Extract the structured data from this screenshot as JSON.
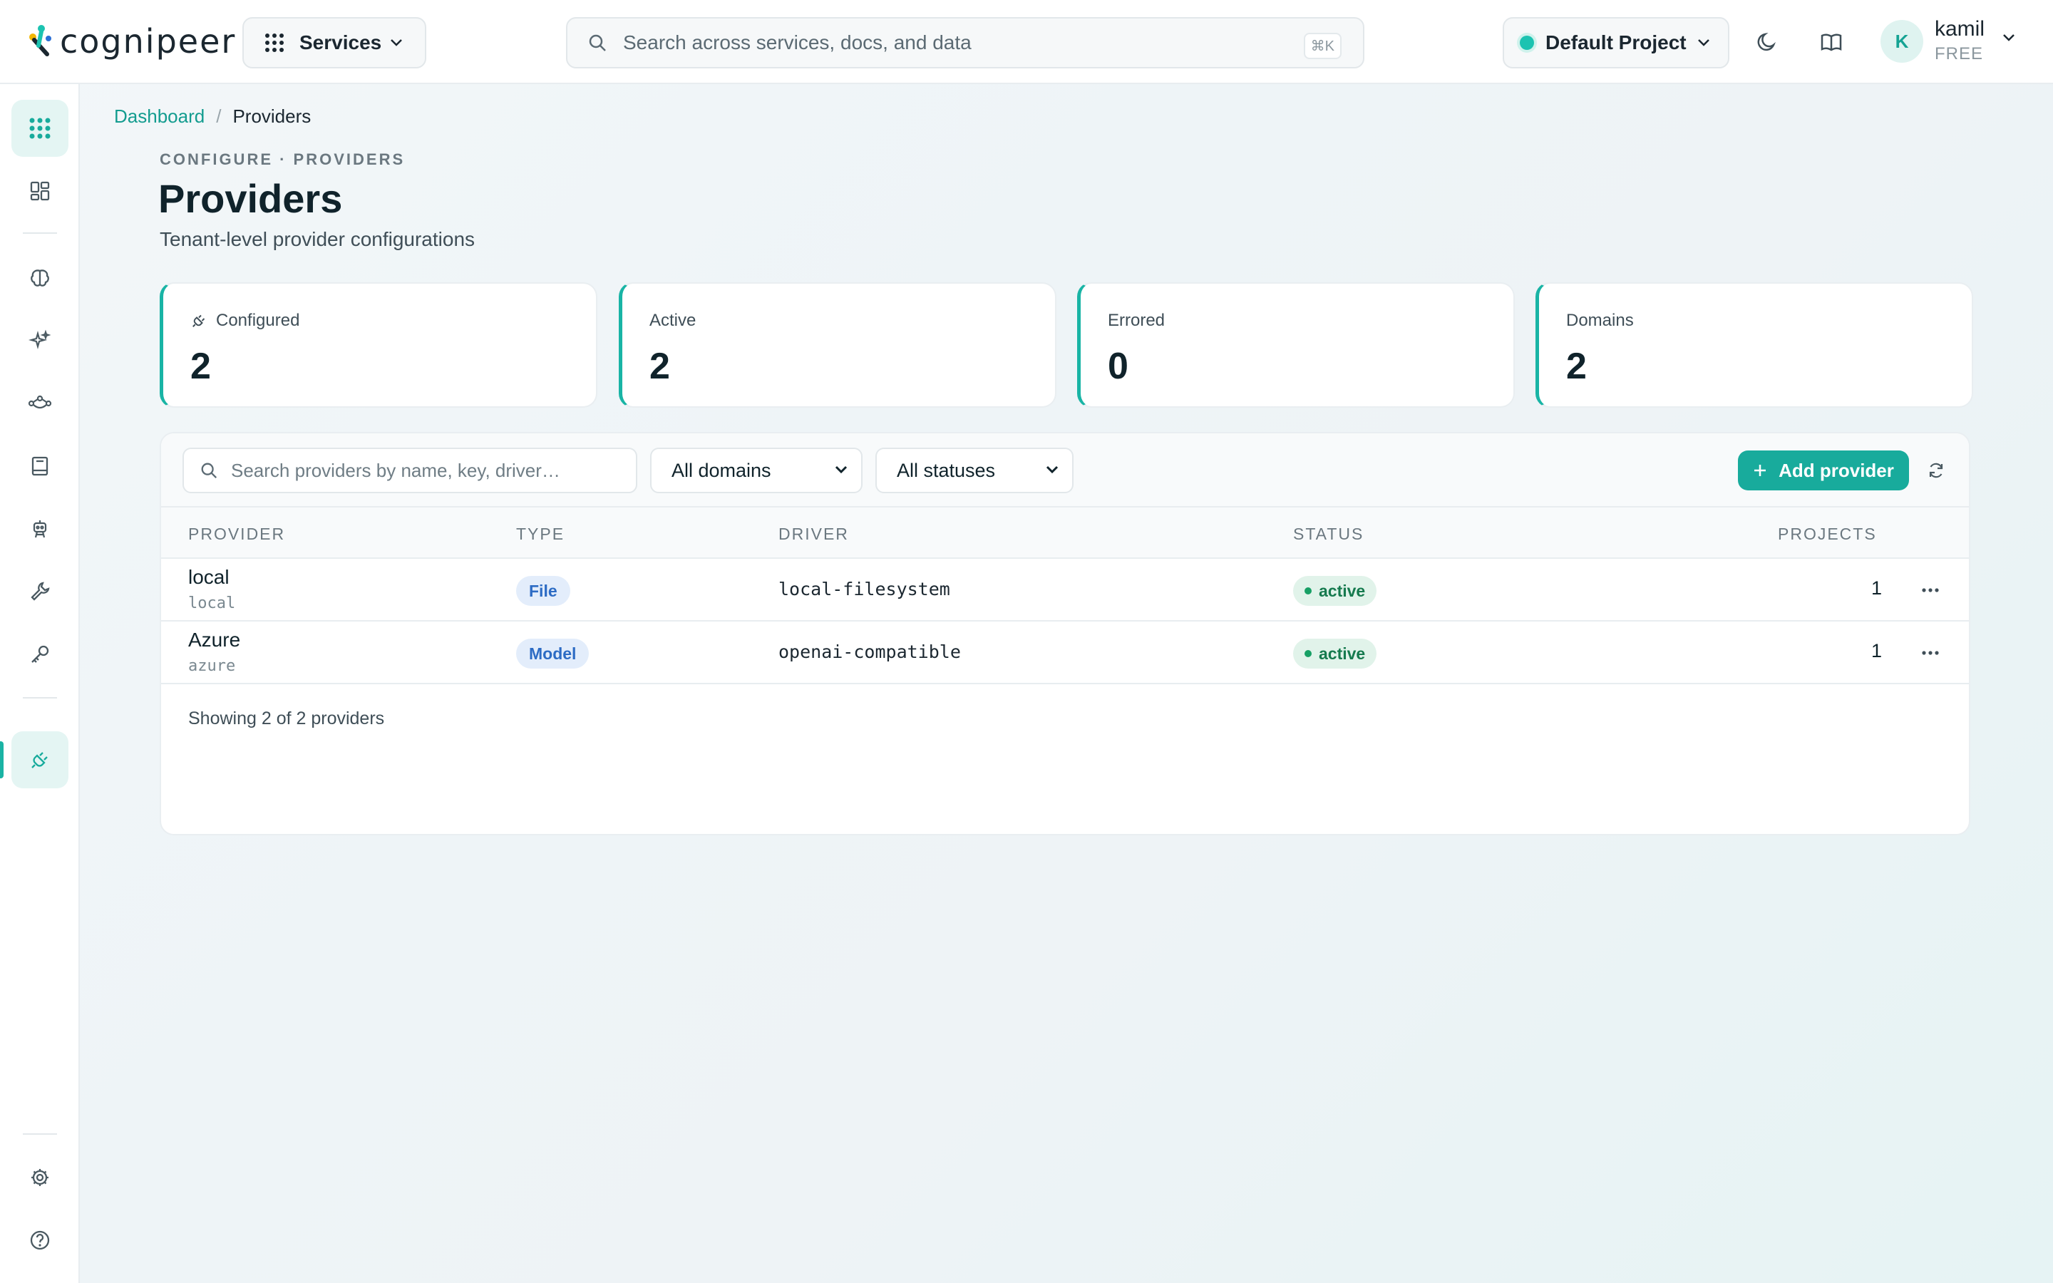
{
  "brand": {
    "logo_text": "cognipeer",
    "accent": "#18ab9c"
  },
  "topbar": {
    "services_label": "Services",
    "search_placeholder": "Search across services, docs, and data",
    "search_shortcut": "⌘K",
    "project_label": "Default Project",
    "user": {
      "initial": "K",
      "name": "kamil",
      "plan": "FREE"
    }
  },
  "sidebar": {
    "items": [
      "apps-grid-icon",
      "dashboard-icon",
      "brain-icon",
      "sparkles-icon",
      "flow-icon",
      "notebook-icon",
      "agent-icon",
      "tools-icon",
      "key-icon",
      "plug-icon",
      "settings-icon",
      "help-icon"
    ],
    "active": "plug-icon"
  },
  "breadcrumb": {
    "root": "Dashboard",
    "sep": "/",
    "current": "Providers"
  },
  "page": {
    "eyebrow": "CONFIGURE · PROVIDERS",
    "title": "Providers",
    "subtitle": "Tenant-level provider configurations"
  },
  "stats": [
    {
      "label": "Configured",
      "value": "2"
    },
    {
      "label": "Active",
      "value": "2"
    },
    {
      "label": "Errored",
      "value": "0"
    },
    {
      "label": "Domains",
      "value": "2"
    }
  ],
  "toolbar": {
    "search_placeholder": "Search providers by name, key, driver…",
    "domain_filter": "All domains",
    "status_filter": "All statuses",
    "add_label": "Add provider"
  },
  "table": {
    "columns": [
      "PROVIDER",
      "TYPE",
      "DRIVER",
      "STATUS",
      "PROJECTS"
    ],
    "rows": [
      {
        "name": "local",
        "key": "local",
        "type": "File",
        "driver": "local-filesystem",
        "status": "active",
        "projects": "1"
      },
      {
        "name": "Azure",
        "key": "azure",
        "type": "Model",
        "driver": "openai-compatible",
        "status": "active",
        "projects": "1"
      }
    ],
    "footer": "Showing 2 of 2 providers"
  }
}
